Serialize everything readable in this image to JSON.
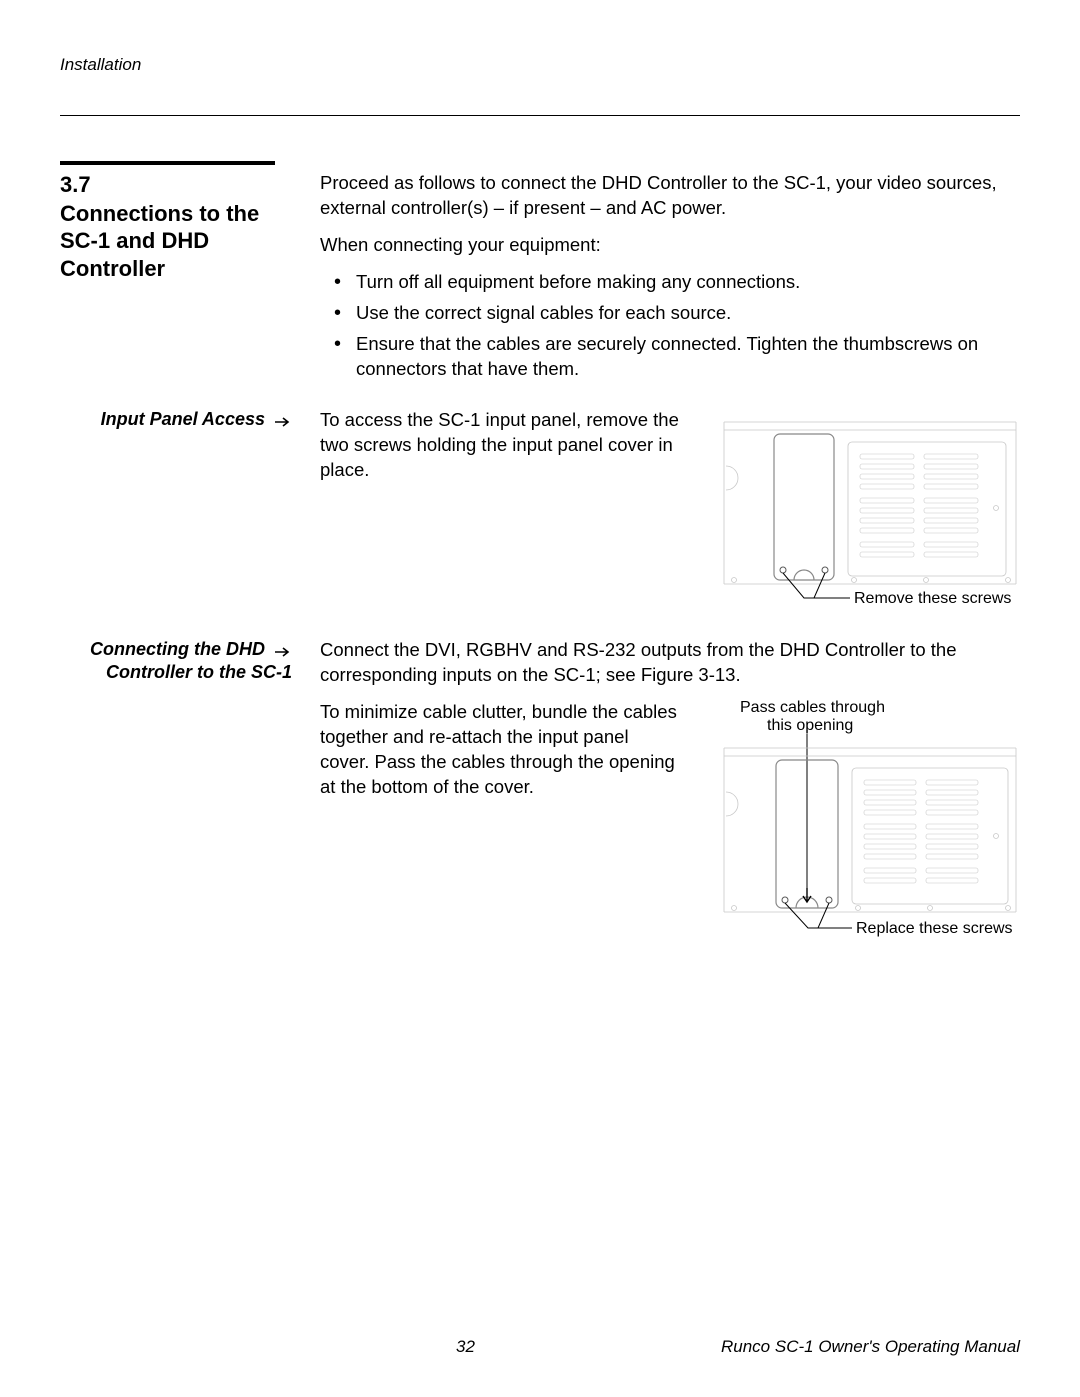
{
  "header": {
    "chapter": "Installation"
  },
  "section": {
    "number": "3.7",
    "title": "Connections to the SC-1 and DHD Controller",
    "intro1": "Proceed as follows to connect the DHD Controller to the SC-1, your video sources, external controller(s) – if present – and AC power.",
    "intro2": "When connecting your equipment:",
    "bullets": [
      "Turn off all equipment before making any connections.",
      "Use the correct signal cables for each source.",
      "Ensure that the cables are securely connected. Tighten the thumbscrews on connectors that have them."
    ]
  },
  "sub1": {
    "label": "Input Panel Access",
    "text": "To access the SC-1 input panel, remove the two screws holding the input panel cover in place.",
    "callout": "Remove these screws"
  },
  "sub2": {
    "label_line1": "Connecting the DHD",
    "label_line2": "Controller to the SC-1",
    "para1": "Connect the DVI, RGBHV and RS-232 outputs from the DHD Controller to the corresponding inputs on the SC-1; see Figure 3-13.",
    "para2": "To minimize cable clutter, bundle the cables together and re-attach the input panel cover. Pass the cables through the opening at the bottom of the cover.",
    "callout_top": "Pass cables through this opening",
    "callout_bottom": "Replace these screws"
  },
  "footer": {
    "page": "32",
    "doc": "Runco SC-1 Owner's Operating Manual"
  }
}
